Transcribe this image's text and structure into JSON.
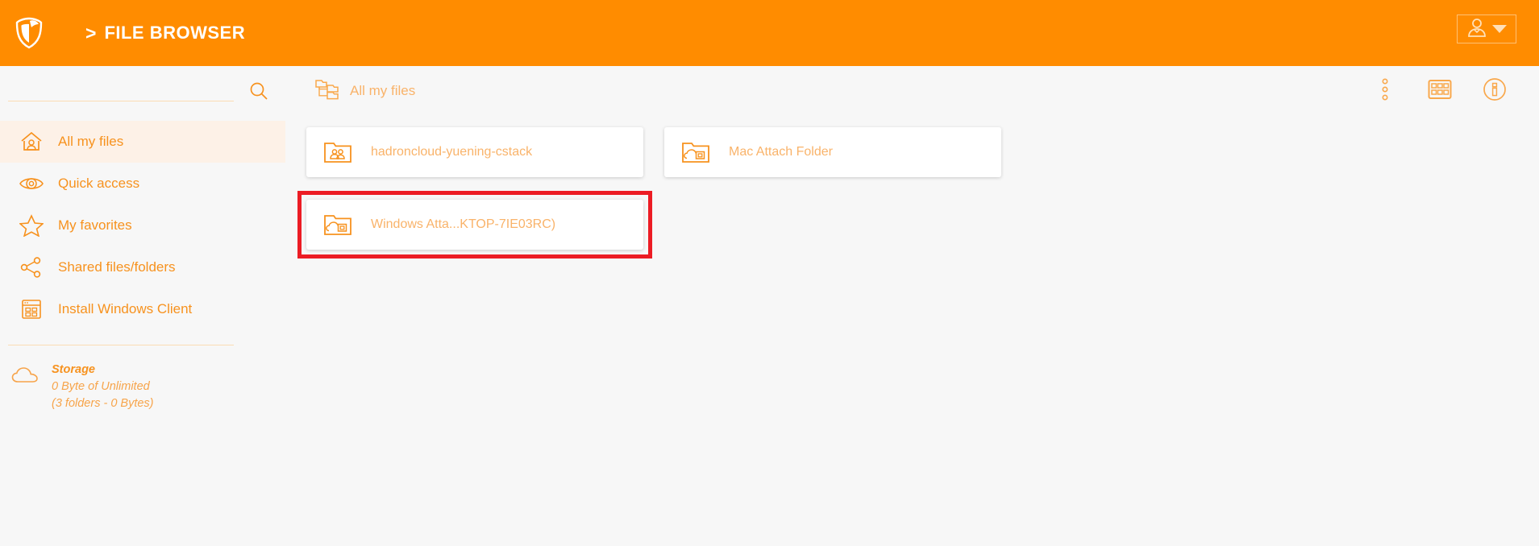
{
  "header": {
    "logo_icon": "shield-logo-icon",
    "separator": ">",
    "title": "FILE BROWSER",
    "account": {
      "icon": "user-avatar-icon",
      "caret_icon": "chevron-down-icon"
    },
    "background_color": "#ff8c00"
  },
  "sidebar": {
    "search": {
      "value": "",
      "placeholder": "",
      "icon": "search-icon"
    },
    "items": [
      {
        "label": "All my files",
        "icon": "home-user-icon",
        "active": true
      },
      {
        "label": "Quick access",
        "icon": "eye-icon",
        "active": false
      },
      {
        "label": "My favorites",
        "icon": "star-icon",
        "active": false
      },
      {
        "label": "Shared files/folders",
        "icon": "share-nodes-icon",
        "active": false
      },
      {
        "label": "Install Windows Client",
        "icon": "windows-app-icon",
        "active": false
      }
    ],
    "storage": {
      "icon": "cloud-icon",
      "title": "Storage",
      "usage": "0 Byte of Unlimited",
      "detail": "(3 folders - 0 Bytes)"
    },
    "accent_color": "#f7921e",
    "active_background": "#fdf1e7"
  },
  "main": {
    "breadcrumb": {
      "icon": "folder-tree-icon",
      "label": "All my files"
    },
    "toolbar_actions": [
      {
        "name": "more-options-button",
        "icon": "kebab-menu-icon"
      },
      {
        "name": "grid-view-button",
        "icon": "grid-view-icon"
      },
      {
        "name": "info-button",
        "icon": "info-circle-icon"
      }
    ],
    "cards": [
      {
        "label": "hadroncloud-yuening-cstack",
        "icon": "shared-folder-icon",
        "highlighted": false
      },
      {
        "label": "Mac Attach Folder",
        "icon": "cloud-folder-icon",
        "highlighted": false
      },
      {
        "label": "Windows Atta...KTOP-7IE03RC)",
        "icon": "cloud-folder-icon",
        "highlighted": true
      }
    ],
    "highlight_color": "#ec1c24",
    "card_text_color": "#f9b36a"
  }
}
